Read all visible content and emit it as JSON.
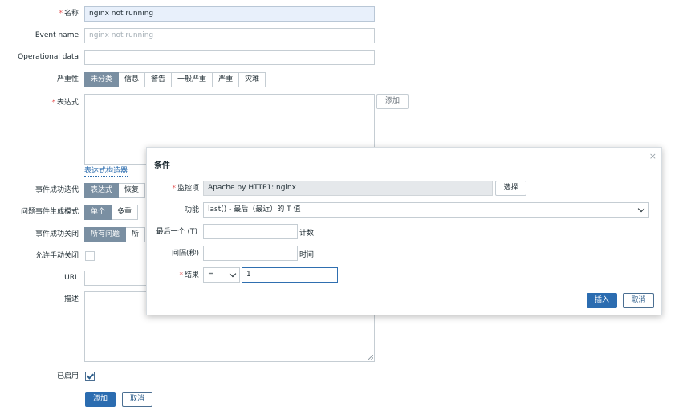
{
  "form": {
    "name_label": "名称",
    "name_value": "nginx not running",
    "event_name_label": "Event name",
    "event_name_placeholder": "nginx not running",
    "opdata_label": "Operational data",
    "severity_label": "严重性",
    "severity_options": [
      "未分类",
      "信息",
      "警告",
      "一般严重",
      "严重",
      "灾难"
    ],
    "severity_selected": 0,
    "expression_label": "表达式",
    "add_button": "添加",
    "expression_builder_link": "表达式构造器",
    "ok_event_gen_label": "事件成功迭代",
    "ok_event_gen_options": [
      "表达式",
      "恢复"
    ],
    "problem_mode_label": "问题事件生成模式",
    "problem_mode_options": [
      "单个",
      "多重"
    ],
    "ok_close_label": "事件成功关闭",
    "ok_close_options": [
      "所有问题",
      "所"
    ],
    "manual_close_label": "允许手动关闭",
    "manual_close_checked": false,
    "url_label": "URL",
    "description_label": "描述",
    "enabled_label": "已启用",
    "enabled_checked": true,
    "submit_button": "添加",
    "cancel_button": "取消"
  },
  "dialog": {
    "title": "条件",
    "close_glyph": "×",
    "item_label": "监控项",
    "item_value": "Apache by HTTP1: nginx",
    "select_button": "选择",
    "function_label": "功能",
    "function_value": "last() - 最后（最近）的 T 值",
    "last_label": "最后一个 (T)",
    "last_unit": "计数",
    "interval_label": "间隔(秒)",
    "interval_unit": "时间",
    "result_label": "结果",
    "result_operator": "=",
    "result_value": "1",
    "insert_button": "插入",
    "cancel_button": "取消"
  },
  "colors": {
    "primary": "#2b6cb0",
    "segment_active": "#7a8fa2",
    "required": "#e45959"
  }
}
